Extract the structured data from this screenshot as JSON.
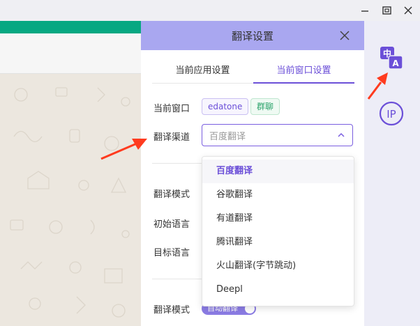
{
  "panel": {
    "title": "翻译设置",
    "tabs": [
      {
        "label": "当前应用设置"
      },
      {
        "label": "当前窗口设置"
      }
    ],
    "current_window_label": "当前窗口",
    "tags": [
      "edatone",
      "群聊"
    ],
    "channel_label": "翻译渠道",
    "channel_placeholder": "百度翻译",
    "mode_label": "翻译模式",
    "source_lang_label": "初始语言",
    "target_lang_label": "目标语言",
    "mode_label_2": "翻译模式",
    "auto_translate_label": "自动翻译",
    "auto_translate_on": true
  },
  "dropdown": {
    "options": [
      "百度翻译",
      "谷歌翻译",
      "有道翻译",
      "腾讯翻译",
      "火山翻译(字节跳动)",
      "Deepl"
    ],
    "selected": "百度翻译"
  },
  "sidebar": {
    "translate_icon": {
      "top": "中",
      "bottom": "A"
    },
    "ip_icon": "IP"
  },
  "colors": {
    "accent": "#6b4fd8",
    "header": "#a9a7f0",
    "app_green": "#07a882",
    "annotation": "#ff3b1f"
  }
}
